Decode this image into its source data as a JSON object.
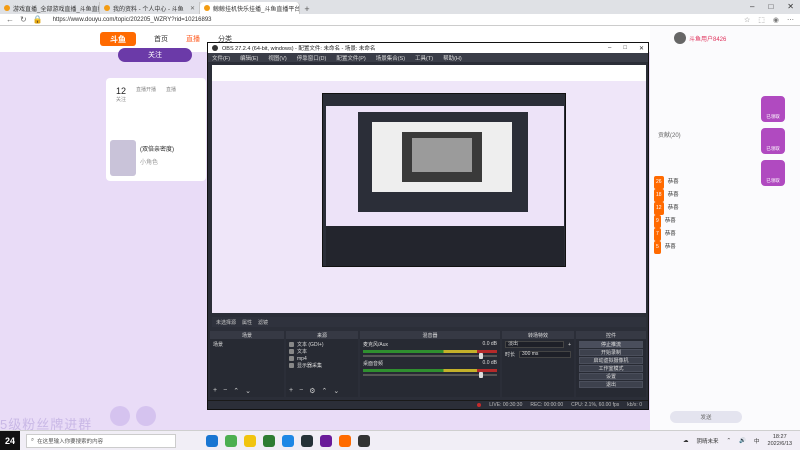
{
  "browser": {
    "tabs": [
      {
        "label": "游戏直播_全部游戏直播_斗鱼直播",
        "active": false
      },
      {
        "label": "我的资料 - 个人中心 - 斗鱼",
        "active": false
      },
      {
        "label": "鲸鲸挂机快乐挂播_斗鱼直播平台",
        "active": true
      }
    ],
    "new_tab": "+",
    "url": "https://www.douyu.com/topic/202205_WZRY?rid=10216893",
    "window_controls": [
      "–",
      "□",
      "✕"
    ]
  },
  "site": {
    "logo": "斗鱼",
    "nav": [
      "首页",
      "直播",
      "分类"
    ],
    "follow_label": "关注",
    "stats": [
      {
        "num": "12",
        "label": "关注"
      },
      {
        "num": "",
        "label": "直播开播"
      },
      {
        "num": "",
        "label": "直播"
      }
    ],
    "room_title": "(双倍亲密度)",
    "room_sub": "小角色",
    "overlay_text": "5级粉丝牌进群",
    "right_user": "斗鱼用户8426",
    "right_tab": "贡献(20)",
    "right_list": [
      "恭喜",
      "恭喜",
      "恭喜",
      "恭喜",
      "恭喜",
      "恭喜"
    ],
    "gifts": [
      "已领取",
      "已领取",
      "已领取"
    ],
    "send_label": "发送"
  },
  "obs": {
    "title": "OBS 27.2.4 (64-bit, windows) - 配置文件: 未命名 - 场景: 未命名",
    "menu": [
      "文件(F)",
      "编辑(E)",
      "视图(V)",
      "停靠窗口(D)",
      "配置文件(P)",
      "场景集合(S)",
      "工具(T)",
      "帮助(H)"
    ],
    "scene_bar": [
      "未选择源",
      "属性",
      "滤镜"
    ],
    "docks": {
      "scenes": "场景",
      "sources": "来源",
      "mixer": "混音器",
      "transitions": "转场特效",
      "controls": "控件"
    },
    "scene_name": "场景",
    "sources": [
      {
        "icon": "text-icon",
        "name": "文本 (GDI+)"
      },
      {
        "icon": "image-icon",
        "name": "文本"
      },
      {
        "icon": "image-icon",
        "name": "mp4"
      },
      {
        "icon": "display-icon",
        "name": "显示器采集"
      }
    ],
    "mixer": [
      {
        "name": "麦克风/Aux",
        "db": "0.0 dB"
      },
      {
        "name": "桌面音频",
        "db": "0.0 dB"
      }
    ],
    "transition": {
      "type": "淡出",
      "duration_label": "时长",
      "duration": "300 ms"
    },
    "controls": [
      "停止推流",
      "开始录制",
      "启动虚拟摄像机",
      "工作室模式",
      "设置",
      "退出"
    ],
    "status": {
      "live": "LIVE: 00:30:30",
      "rec": "REC: 00:00:00",
      "cpu": "CPU: 2.1%, 60.00 fps",
      "kbps": "kb/s: 0"
    }
  },
  "taskbar": {
    "logo": "24",
    "search_placeholder": "在这里输入你要搜索的内容",
    "weather": "阴晴未来",
    "time": "18:27",
    "date": "2022/6/13"
  },
  "colors": {
    "accent": "#ff6a00",
    "purple": "#6b3aa8",
    "obs_bg": "#2b2e38"
  }
}
